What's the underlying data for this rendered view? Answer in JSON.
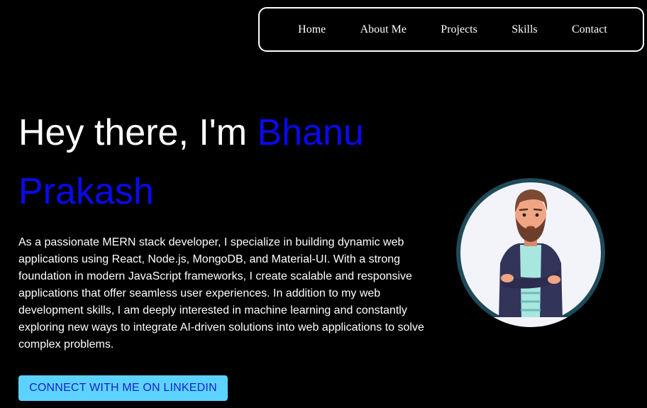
{
  "nav": {
    "items": [
      {
        "label": "Home"
      },
      {
        "label": "About Me"
      },
      {
        "label": "Projects"
      },
      {
        "label": "Skills"
      },
      {
        "label": "Contact"
      }
    ]
  },
  "hero": {
    "greeting": "Hey there, I'm ",
    "name": "Bhanu Prakash",
    "bio": "As a passionate MERN stack developer, I specialize in building dynamic web applications using React, Node.js, MongoDB, and Material-UI. With a strong foundation in modern JavaScript frameworks, I create scalable and responsive applications that offer seamless user experiences. In addition to my web development skills, I am deeply interested in machine learning and constantly exploring new ways to integrate AI-driven solutions into web applications to solve complex problems.",
    "cta_label": "CONNECT WITH ME ON LINKEDIN"
  },
  "avatar": {
    "icon": "developer-avatar-illustration"
  },
  "colors": {
    "background": "#000000",
    "name_accent": "#0a0aee",
    "button_bg": "#5cd3ff",
    "button_text": "#1a22c8",
    "avatar_ring": "#1e4a5a"
  }
}
